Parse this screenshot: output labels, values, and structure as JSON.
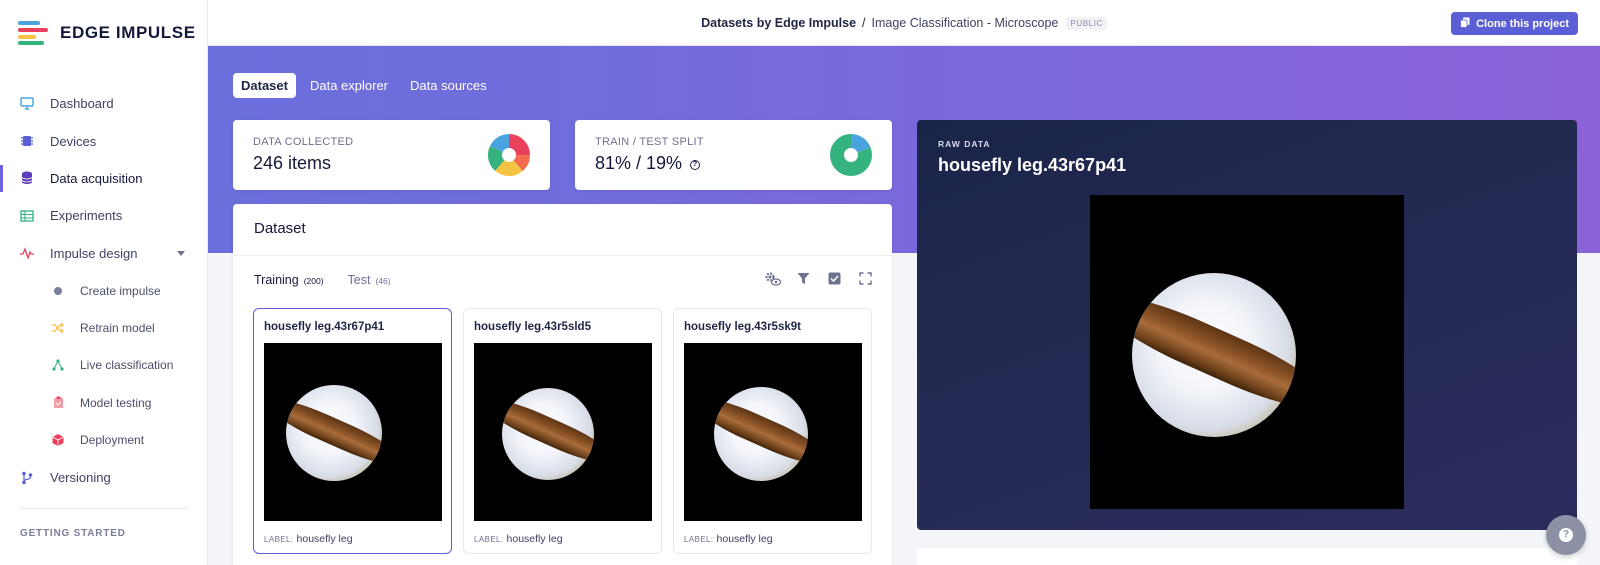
{
  "brand": {
    "name": "EDGE IMPULSE"
  },
  "topbar": {
    "owner": "Datasets by Edge Impulse",
    "separator": "/",
    "project": "Image Classification - Microscope",
    "visibility": "PUBLIC",
    "clone_label": "Clone this project"
  },
  "sidebar": {
    "items": [
      {
        "label": "Dashboard",
        "icon": "monitor-icon"
      },
      {
        "label": "Devices",
        "icon": "chip-icon"
      },
      {
        "label": "Data acquisition",
        "icon": "database-icon"
      },
      {
        "label": "Experiments",
        "icon": "table-icon"
      },
      {
        "label": "Impulse design",
        "icon": "pulse-icon"
      },
      {
        "label": "Create impulse",
        "icon": "dot-icon"
      },
      {
        "label": "Retrain model",
        "icon": "shuffle-icon"
      },
      {
        "label": "Live classification",
        "icon": "nodes-icon"
      },
      {
        "label": "Model testing",
        "icon": "clipboard-icon"
      },
      {
        "label": "Deployment",
        "icon": "cube-icon"
      },
      {
        "label": "Versioning",
        "icon": "branch-icon"
      }
    ],
    "section_label": "GETTING STARTED"
  },
  "tabs": [
    "Dataset",
    "Data explorer",
    "Data sources"
  ],
  "stats": {
    "collected": {
      "label": "DATA COLLECTED",
      "value": "246 items"
    },
    "split": {
      "label": "TRAIN / TEST SPLIT",
      "value": "81% / 19%"
    }
  },
  "dataset": {
    "title": "Dataset",
    "subtabs": [
      {
        "label": "Training",
        "count": "(200)"
      },
      {
        "label": "Test",
        "count": "(46)"
      }
    ],
    "label_key": "LABEL:",
    "samples": [
      {
        "name": "housefly leg.43r67p41",
        "label": "housefly leg"
      },
      {
        "name": "housefly leg.43r5sld5",
        "label": "housefly leg"
      },
      {
        "name": "housefly leg.43r5sk9t",
        "label": "housefly leg"
      }
    ]
  },
  "raw_data": {
    "label": "RAW DATA",
    "title": "housefly leg.43r67p41"
  },
  "colors": {
    "accent": "#5b5fd6",
    "banner_start": "#6a6fdc",
    "banner_end": "#8c62d8",
    "raw_panel": "#1a2348"
  }
}
